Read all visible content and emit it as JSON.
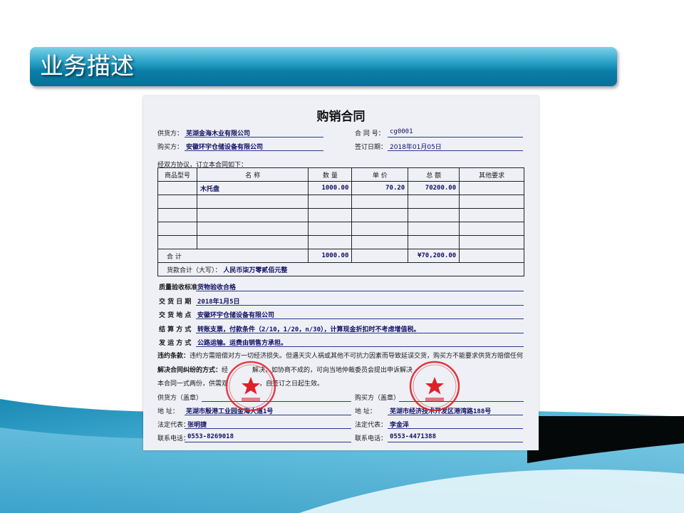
{
  "slide": {
    "title": "业务描述",
    "colors": {
      "accent": "#0b7aa3",
      "wave": "#3aa3c9"
    }
  },
  "contract": {
    "title": "购销合同",
    "supplier_label": "供货方：",
    "supplier_value": "芜湖金海木业有限公司",
    "contract_no_label": "合 同 号：",
    "contract_no_value": "cg0001",
    "buyer_label": "购买方：",
    "buyer_value": "安徽环宇仓储设备有限公司",
    "sign_date_label": "签订日期：",
    "sign_date_value": "2018年01月05日",
    "intro": "经双方协议，订立本合同如下：",
    "table": {
      "headers": [
        "商品型号",
        "名 称",
        "数 量",
        "单 价",
        "总 额",
        "其他要求"
      ],
      "rows": [
        [
          "",
          "木托盘",
          "1000.00",
          "70.20",
          "70200.00",
          ""
        ]
      ],
      "total_label": "合 计",
      "total_qty": "1000.00",
      "total_amount": "¥70,200.00",
      "capital_label": "货款合计（大写）：",
      "capital_value": "人民币柒万零贰佰元整"
    },
    "quality_label": "质量验收标准",
    "quality_value": "货物验收合格",
    "delivery_date_label": "交 货 日 期",
    "delivery_date_value": "2018年1月5日",
    "delivery_place_label": "交 货 地 点",
    "delivery_place_value": "安徽环宇仓储设备有限公司",
    "settlement_label": "结 算 方 式",
    "settlement_value": "转账支票，付款条件（2/10，1/20，n/30），计算现金折扣时不考虑增值税。",
    "shipping_label": "发 运 方 式",
    "shipping_value": "公路运输。运费由销售方承担。",
    "breach_label": "违约条款：",
    "breach_text": "违约方需赔偿对方一切经济损失。但遇天灾人祸或其他不可抗力因素而导致延误交货，购买方不能要求供货方赔偿任何",
    "dispute_label": "解决合同纠纷的方式：",
    "dispute_text_a": "经",
    "dispute_text_b": "解决，如协商不成的，可向当地仲裁委员会提出申诉解决",
    "copies_text_a": "本合同一式两份，供需双",
    "copies_text_b": "，自签订之日起生效。",
    "supplier_seal_label": "供货方（盖章）",
    "buyer_seal_label": "购买方（盖章）",
    "address_label": "地 址：",
    "supplier_address": "芜湖市殷港工业园金海大道1号",
    "buyer_address": "芜湖市经济技术开发区港湾路188号",
    "legal_rep_label": "法定代表：",
    "supplier_rep": "张明捷",
    "buyer_rep": "李金泽",
    "phone_label": "联系电话：",
    "supplier_phone": "0553-8269018",
    "buyer_phone": "0553-4471388",
    "seal_colors": "#e0202a"
  }
}
